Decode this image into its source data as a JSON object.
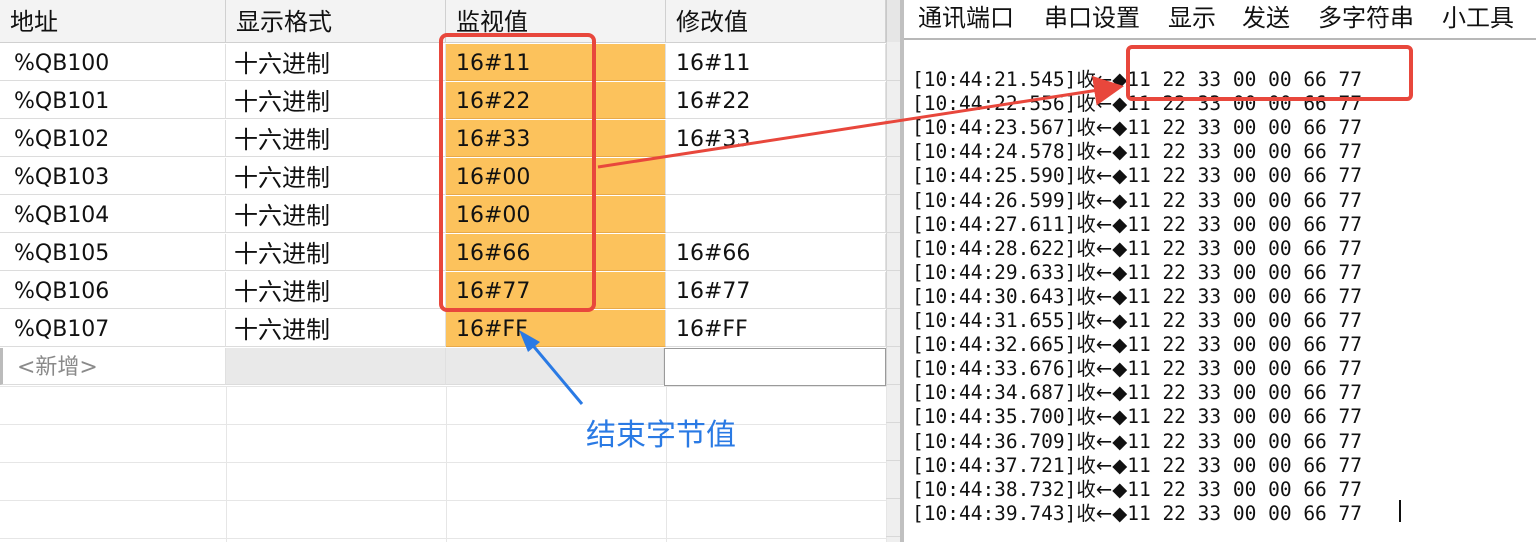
{
  "watch_table": {
    "headers": [
      "地址",
      "显示格式",
      "监视值",
      "修改值"
    ],
    "rows": [
      {
        "address": "%QB100",
        "format": "十六进制",
        "monitor": "16#11",
        "modify": "16#11"
      },
      {
        "address": "%QB101",
        "format": "十六进制",
        "monitor": "16#22",
        "modify": "16#22"
      },
      {
        "address": "%QB102",
        "format": "十六进制",
        "monitor": "16#33",
        "modify": "16#33"
      },
      {
        "address": "%QB103",
        "format": "十六进制",
        "monitor": "16#00",
        "modify": ""
      },
      {
        "address": "%QB104",
        "format": "十六进制",
        "monitor": "16#00",
        "modify": ""
      },
      {
        "address": "%QB105",
        "format": "十六进制",
        "monitor": "16#66",
        "modify": "16#66"
      },
      {
        "address": "%QB106",
        "format": "十六进制",
        "monitor": "16#77",
        "modify": "16#77"
      },
      {
        "address": "%QB107",
        "format": "十六进制",
        "monitor": "16#FF",
        "modify": "16#FF"
      }
    ],
    "new_row_label": "<新增>"
  },
  "terminal": {
    "menu": [
      "通讯端口",
      "串口设置",
      "显示",
      "发送",
      "多字符串",
      "小工具"
    ],
    "direction": "收←◆",
    "log": [
      {
        "time": "[10:44:21.545]",
        "data": "11 22 33 00 00 66 77"
      },
      {
        "time": "[10:44:22.556]",
        "data": "11 22 33 00 00 66 77"
      },
      {
        "time": "[10:44:23.567]",
        "data": "11 22 33 00 00 66 77"
      },
      {
        "time": "[10:44:24.578]",
        "data": "11 22 33 00 00 66 77"
      },
      {
        "time": "[10:44:25.590]",
        "data": "11 22 33 00 00 66 77"
      },
      {
        "time": "[10:44:26.599]",
        "data": "11 22 33 00 00 66 77"
      },
      {
        "time": "[10:44:27.611]",
        "data": "11 22 33 00 00 66 77"
      },
      {
        "time": "[10:44:28.622]",
        "data": "11 22 33 00 00 66 77"
      },
      {
        "time": "[10:44:29.633]",
        "data": "11 22 33 00 00 66 77"
      },
      {
        "time": "[10:44:30.643]",
        "data": "11 22 33 00 00 66 77"
      },
      {
        "time": "[10:44:31.655]",
        "data": "11 22 33 00 00 66 77"
      },
      {
        "time": "[10:44:32.665]",
        "data": "11 22 33 00 00 66 77"
      },
      {
        "time": "[10:44:33.676]",
        "data": "11 22 33 00 00 66 77"
      },
      {
        "time": "[10:44:34.687]",
        "data": "11 22 33 00 00 66 77"
      },
      {
        "time": "[10:44:35.700]",
        "data": "11 22 33 00 00 66 77"
      },
      {
        "time": "[10:44:36.709]",
        "data": "11 22 33 00 00 66 77"
      },
      {
        "time": "[10:44:37.721]",
        "data": "11 22 33 00 00 66 77"
      },
      {
        "time": "[10:44:38.732]",
        "data": "11 22 33 00 00 66 77"
      },
      {
        "time": "[10:44:39.743]",
        "data": "11 22 33 00 00 66 77"
      }
    ]
  },
  "annotations": {
    "end_byte_label": "结束字节值",
    "highlight_color": "#e8473c",
    "callout_color": "#2a7ae4"
  }
}
